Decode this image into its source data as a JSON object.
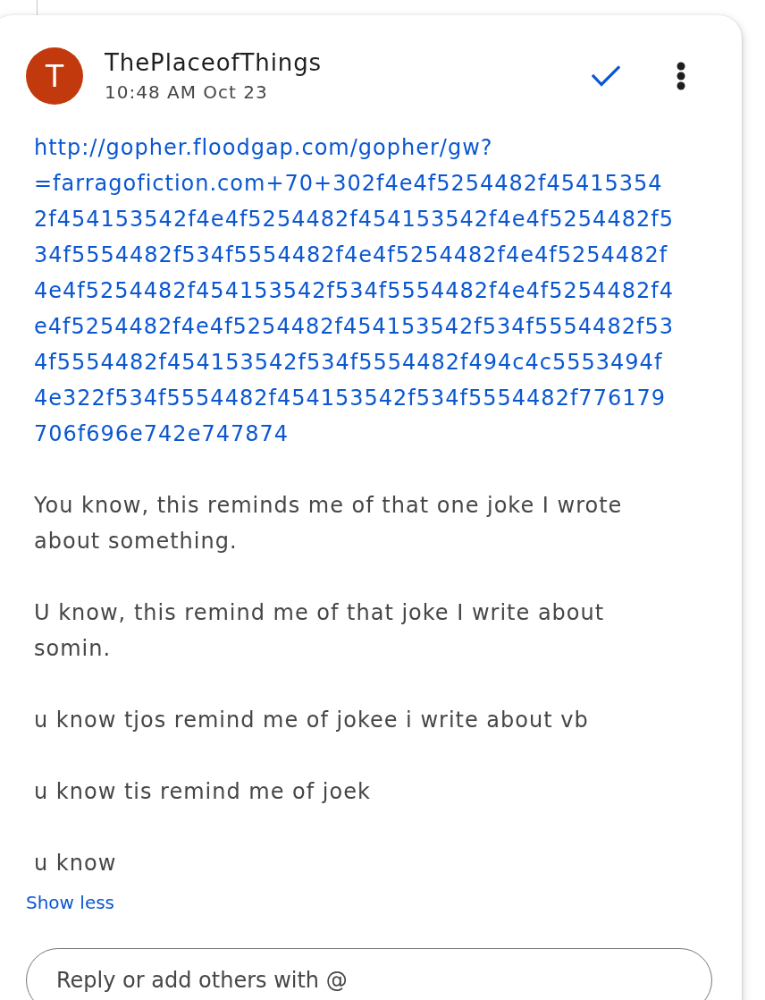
{
  "comment": {
    "avatar_letter": "T",
    "author": "ThePlaceofThings",
    "time": "10:48 AM Oct 23",
    "link": "http://gopher.floodgap.com/gopher/gw?=farragofiction.com+70+302f4e4f5254482f454153542f454153542f4e4f5254482f454153542f4e4f5254482f534f5554482f534f5554482f4e4f5254482f4e4f5254482f4e4f5254482f454153542f534f5554482f4e4f5254482f4e4f5254482f4e4f5254482f454153542f534f5554482f534f5554482f454153542f534f5554482f494c4c5553494f4e322f534f5554482f454153542f534f5554482f776179706f696e742e747874",
    "paragraphs": [
      "You know, this reminds me of that one joke I wrote about something.",
      "U know, this remind me of that joke I write about somin.",
      "u know tjos remind me of jokee i write about vb",
      "u know tis remind me of joek",
      "u know"
    ],
    "toggle_label": "Show less"
  },
  "reply": {
    "placeholder": "Reply or add others with @"
  }
}
